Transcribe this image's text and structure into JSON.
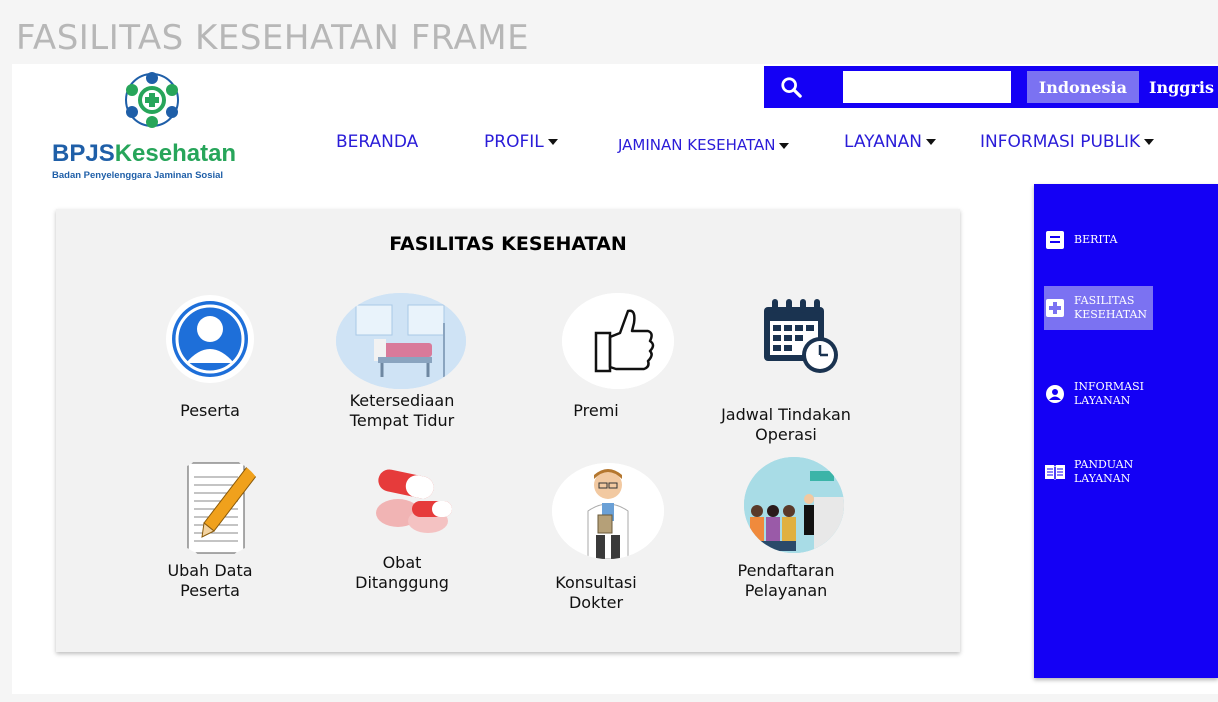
{
  "frame_title": "FASILITAS KESEHATAN FRAME",
  "logo": {
    "brand": "BPJS",
    "brand_accent": "Kesehatan",
    "subtitle": "Badan Penyelenggara Jaminan Sosial"
  },
  "topbar": {
    "search_icon": "search-icon",
    "search_value": "",
    "lang_active": "Indonesia",
    "lang_other": "Inggris"
  },
  "nav": {
    "items": [
      {
        "label": "BERANDA"
      },
      {
        "label": "PROFIL"
      },
      {
        "label": "JAMINAN KESEHATAN"
      },
      {
        "label": "LAYANAN"
      },
      {
        "label": "INFORMASI PUBLIK"
      }
    ]
  },
  "main": {
    "title": "FASILITAS KESEHATAN",
    "tiles": [
      {
        "label": "Peserta",
        "icon": "user-icon"
      },
      {
        "label": "Ketersediaan\nTempat Tidur",
        "icon": "hospital-bed-icon"
      },
      {
        "label": "Premi",
        "icon": "thumbs-up-icon"
      },
      {
        "label": "Jadwal Tindakan\nOperasi",
        "icon": "calendar-clock-icon"
      },
      {
        "label": "Ubah Data\nPeserta",
        "icon": "edit-document-icon"
      },
      {
        "label": "Obat\nDitanggung",
        "icon": "pills-icon"
      },
      {
        "label": "Konsultasi\nDokter",
        "icon": "doctor-icon"
      },
      {
        "label": "Pendaftaran\nPelayanan",
        "icon": "registration-icon"
      }
    ]
  },
  "sidebar": {
    "items": [
      {
        "label": "BERITA",
        "icon": "news-icon",
        "active": false
      },
      {
        "label": "FASILITAS\nKESEHATAN",
        "icon": "plus-icon",
        "active": true
      },
      {
        "label": "INFORMASI\nLAYANAN",
        "icon": "user-circle-icon",
        "active": false
      },
      {
        "label": "PANDUAN\nLAYANAN",
        "icon": "book-icon",
        "active": false
      }
    ]
  },
  "colors": {
    "primary": "#1400f5",
    "accent": "#7b72f2",
    "nav_text": "#2a1cd8",
    "card_bg": "#f2f2f2"
  }
}
